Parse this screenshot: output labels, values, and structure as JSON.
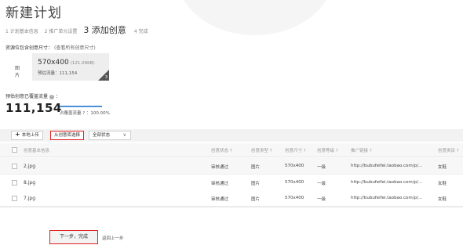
{
  "page": {
    "title": "新建计划"
  },
  "steps": [
    {
      "label": "1 计划基本信息",
      "active": false
    },
    {
      "label": "2 推广单元设置",
      "active": false
    },
    {
      "label": "3 添加创意",
      "active": true
    },
    {
      "label": "4 完成",
      "active": false
    }
  ],
  "size_section": {
    "label": "资源位包含创意尺寸：",
    "note": "(查看所有创意尺寸)",
    "type_label": "图片",
    "card": {
      "dimension": "570x400",
      "file_size": "(121.09KB)",
      "traffic": "预估流量：111,154",
      "count": "3"
    }
  },
  "coverage": {
    "label": "预估创意已覆盖流量",
    "help": "?",
    "value": "111,154",
    "percent_text": "占覆盖流量 ? ：100.00%",
    "percent": 100
  },
  "toolbar": {
    "local_upload_icon": "+",
    "local_upload": "本地上传",
    "from_library": "从创意库选择",
    "status_filter": "全部状态",
    "status_chevron": "∨"
  },
  "table": {
    "columns": {
      "info": "创意基本信息",
      "review": "创意状态 ?",
      "type": "创意类型 ?",
      "size": "创意尺寸 ?",
      "level": "创意等级 ?",
      "url": "推广链接 ?",
      "category": "创意类目 ?"
    },
    "rows": [
      {
        "name": "2.jpg",
        "review": "审核通过",
        "type": "图片",
        "size": "570x400",
        "level": "一级",
        "url": "http://bubufeifei.taobao.com/p/...",
        "category": "女鞋"
      },
      {
        "name": "8.jpg",
        "review": "审核通过",
        "type": "图片",
        "size": "570x400",
        "level": "一级",
        "url": "http://bubufeifei.taobao.com/p/...",
        "category": "女鞋"
      },
      {
        "name": "7.jpg",
        "review": "审核通过",
        "type": "图片",
        "size": "570x400",
        "level": "一级",
        "url": "http://bubufeifei.taobao.com/p/...",
        "category": "女鞋"
      }
    ]
  },
  "footer": {
    "next_button": "下一步，完成",
    "back_link": "返回上一步"
  },
  "colors": {
    "highlight_border": "#e02020",
    "progress_bar": "#4a90d9"
  }
}
